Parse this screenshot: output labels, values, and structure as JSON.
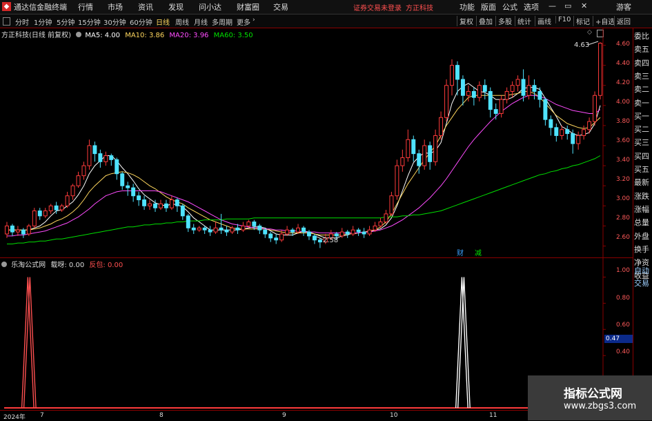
{
  "menubar": {
    "app_title": "通达信金融终端",
    "items": [
      "行情",
      "市场",
      "资讯",
      "发现",
      "问小达",
      "财富圈",
      "交易"
    ],
    "notice": "证券交易未登录",
    "stock_name": "方正科技",
    "right_items": [
      "功能",
      "版面",
      "公式",
      "选项"
    ],
    "guest": "游客"
  },
  "toolbar": {
    "tabs": [
      "分时",
      "1分钟",
      "5分钟",
      "15分钟",
      "30分钟",
      "60分钟",
      "日线",
      "周线",
      "月线",
      "多周期",
      "更多"
    ],
    "active_tab": "日线",
    "right_buttons": [
      "复权",
      "叠加",
      "多股",
      "统计",
      "画线",
      "F10",
      "标记",
      "+自选",
      "返回"
    ]
  },
  "main_chart": {
    "title": "方正科技(日线 前复权)",
    "ma": [
      {
        "label": "MA5: 4.00",
        "color": "#ffffff"
      },
      {
        "label": "MA10: 3.86",
        "color": "#ffd75e"
      },
      {
        "label": "MA20: 3.96",
        "color": "#ff4cff"
      },
      {
        "label": "MA60: 3.50",
        "color": "#00e000"
      }
    ],
    "yticks": [
      "4.60",
      "4.40",
      "4.20",
      "4.00",
      "3.80",
      "3.60",
      "3.40",
      "3.20",
      "3.00",
      "2.80",
      "2.60"
    ],
    "high_label": "4.63",
    "low_label": "2.58",
    "badge_cai": "财",
    "badge_jian": "减"
  },
  "sub_chart": {
    "title": "乐淘公式网",
    "field1": "载呀: 0.00",
    "field2": "反包: 0.00",
    "yticks": [
      "1.00",
      "0.80",
      "0.60",
      "0.40"
    ],
    "current_value": "0.47"
  },
  "xaxis": {
    "labels": [
      "2024年",
      "7",
      "8",
      "9",
      "10",
      "11"
    ]
  },
  "right_panel": [
    "委比",
    "卖五",
    "卖四",
    "卖三",
    "卖二",
    "卖一",
    "买一",
    "买二",
    "买三",
    "买四",
    "买五",
    "最新",
    "涨跌",
    "涨幅",
    "总量",
    "外盘",
    "换手",
    "净资",
    "收益",
    "自动",
    "交易"
  ],
  "brand": {
    "name": "指标公式网",
    "url": "www.zbgs3.com"
  },
  "chart_data": {
    "type": "candlestick",
    "ylim": [
      2.5,
      4.7
    ],
    "candles": [
      [
        2.72,
        2.8,
        2.68,
        2.84
      ],
      [
        2.8,
        2.74,
        2.7,
        2.82
      ],
      [
        2.74,
        2.76,
        2.7,
        2.8
      ],
      [
        2.76,
        2.72,
        2.68,
        2.78
      ],
      [
        2.72,
        2.8,
        2.7,
        2.82
      ],
      [
        2.8,
        2.95,
        2.78,
        2.98
      ],
      [
        2.95,
        2.9,
        2.86,
        2.98
      ],
      [
        2.9,
        2.95,
        2.88,
        2.98
      ],
      [
        2.95,
        3.0,
        2.92,
        3.02
      ],
      [
        3.0,
        2.96,
        2.92,
        3.04
      ],
      [
        2.96,
        3.0,
        2.94,
        3.02
      ],
      [
        3.0,
        3.1,
        2.98,
        3.14
      ],
      [
        3.1,
        3.2,
        3.06,
        3.22
      ],
      [
        3.2,
        3.3,
        3.18,
        3.34
      ],
      [
        3.3,
        3.4,
        3.26,
        3.44
      ],
      [
        3.4,
        3.6,
        3.36,
        3.66
      ],
      [
        3.6,
        3.52,
        3.44,
        3.64
      ],
      [
        3.52,
        3.44,
        3.38,
        3.56
      ],
      [
        3.44,
        3.5,
        3.4,
        3.54
      ],
      [
        3.5,
        3.46,
        3.4,
        3.52
      ],
      [
        3.46,
        3.32,
        3.26,
        3.48
      ],
      [
        3.32,
        3.2,
        3.16,
        3.34
      ],
      [
        3.2,
        3.18,
        3.1,
        3.24
      ],
      [
        3.18,
        3.1,
        3.04,
        3.22
      ],
      [
        3.1,
        3.06,
        3.0,
        3.14
      ],
      [
        3.06,
        3.0,
        2.96,
        3.1
      ],
      [
        3.0,
        3.02,
        2.96,
        3.06
      ],
      [
        3.02,
        2.98,
        2.94,
        3.06
      ],
      [
        2.98,
        3.02,
        2.96,
        3.06
      ],
      [
        3.02,
        2.98,
        2.94,
        3.06
      ],
      [
        2.98,
        3.06,
        2.96,
        3.1
      ],
      [
        3.06,
        3.0,
        2.94,
        3.08
      ],
      [
        3.0,
        2.9,
        2.86,
        3.02
      ],
      [
        2.9,
        2.78,
        2.74,
        2.92
      ],
      [
        2.78,
        2.76,
        2.72,
        2.82
      ],
      [
        2.76,
        2.78,
        2.74,
        2.8
      ],
      [
        2.78,
        2.76,
        2.72,
        2.8
      ],
      [
        2.76,
        2.74,
        2.7,
        2.8
      ],
      [
        2.74,
        2.78,
        2.72,
        2.84
      ],
      [
        2.78,
        2.76,
        2.72,
        2.92
      ],
      [
        2.76,
        2.74,
        2.7,
        2.8
      ],
      [
        2.74,
        2.78,
        2.72,
        2.8
      ],
      [
        2.78,
        2.76,
        2.72,
        2.82
      ],
      [
        2.76,
        2.8,
        2.74,
        2.84
      ],
      [
        2.8,
        2.84,
        2.78,
        2.86
      ],
      [
        2.84,
        2.8,
        2.76,
        2.86
      ],
      [
        2.8,
        2.76,
        2.72,
        2.82
      ],
      [
        2.76,
        2.72,
        2.68,
        2.78
      ],
      [
        2.72,
        2.68,
        2.64,
        2.74
      ],
      [
        2.68,
        2.66,
        2.62,
        2.72
      ],
      [
        2.66,
        2.72,
        2.64,
        2.76
      ],
      [
        2.72,
        2.76,
        2.7,
        2.8
      ],
      [
        2.76,
        2.74,
        2.7,
        2.78
      ],
      [
        2.74,
        2.78,
        2.72,
        2.82
      ],
      [
        2.78,
        2.74,
        2.7,
        2.8
      ],
      [
        2.74,
        2.7,
        2.66,
        2.76
      ],
      [
        2.7,
        2.66,
        2.62,
        2.72
      ],
      [
        2.66,
        2.64,
        2.58,
        2.68
      ],
      [
        2.64,
        2.68,
        2.62,
        2.72
      ],
      [
        2.68,
        2.72,
        2.66,
        2.76
      ],
      [
        2.72,
        2.7,
        2.66,
        2.74
      ],
      [
        2.7,
        2.74,
        2.68,
        2.78
      ],
      [
        2.74,
        2.72,
        2.68,
        2.76
      ],
      [
        2.72,
        2.76,
        2.7,
        2.8
      ],
      [
        2.76,
        2.74,
        2.7,
        2.78
      ],
      [
        2.74,
        2.72,
        2.68,
        2.78
      ],
      [
        2.72,
        2.76,
        2.7,
        2.8
      ],
      [
        2.76,
        2.8,
        2.74,
        2.84
      ],
      [
        2.8,
        2.84,
        2.78,
        2.88
      ],
      [
        2.84,
        2.92,
        2.82,
        2.96
      ],
      [
        2.92,
        3.1,
        2.9,
        3.14
      ],
      [
        3.1,
        3.4,
        3.06,
        3.46
      ],
      [
        3.4,
        3.48,
        3.34,
        3.56
      ],
      [
        3.48,
        3.66,
        3.44,
        3.76
      ],
      [
        3.66,
        3.52,
        3.44,
        3.7
      ],
      [
        3.52,
        3.4,
        3.32,
        3.56
      ],
      [
        3.4,
        3.6,
        3.36,
        3.66
      ],
      [
        3.6,
        3.44,
        3.36,
        3.64
      ],
      [
        3.44,
        3.7,
        3.4,
        3.76
      ],
      [
        3.7,
        3.88,
        3.66,
        3.94
      ],
      [
        3.88,
        4.2,
        3.84,
        4.26
      ],
      [
        4.2,
        4.4,
        4.1,
        4.46
      ],
      [
        4.4,
        4.26,
        4.1,
        4.44
      ],
      [
        4.26,
        4.1,
        4.0,
        4.3
      ],
      [
        4.1,
        4.14,
        4.04,
        4.2
      ],
      [
        4.14,
        4.08,
        4.0,
        4.18
      ],
      [
        4.08,
        4.2,
        4.04,
        4.24
      ],
      [
        4.2,
        4.14,
        4.06,
        4.26
      ],
      [
        4.14,
        3.96,
        3.88,
        4.18
      ],
      [
        3.96,
        3.92,
        3.86,
        4.02
      ],
      [
        3.92,
        4.06,
        3.88,
        4.1
      ],
      [
        4.06,
        4.14,
        4.02,
        4.18
      ],
      [
        4.14,
        4.2,
        4.08,
        4.24
      ],
      [
        4.2,
        4.26,
        4.14,
        4.3
      ],
      [
        4.26,
        4.1,
        4.04,
        4.36
      ],
      [
        4.1,
        4.2,
        4.06,
        4.3
      ],
      [
        4.2,
        4.14,
        4.06,
        4.26
      ],
      [
        4.14,
        4.06,
        3.98,
        4.18
      ],
      [
        4.06,
        3.86,
        3.8,
        4.08
      ],
      [
        3.86,
        3.78,
        3.7,
        3.9
      ],
      [
        3.78,
        3.7,
        3.64,
        3.82
      ],
      [
        3.7,
        3.76,
        3.66,
        3.8
      ],
      [
        3.76,
        3.72,
        3.66,
        3.8
      ],
      [
        3.72,
        3.62,
        3.52,
        3.76
      ],
      [
        3.62,
        3.7,
        3.56,
        3.74
      ],
      [
        3.7,
        3.76,
        3.66,
        3.8
      ],
      [
        3.76,
        3.84,
        3.72,
        3.88
      ],
      [
        3.84,
        4.1,
        3.8,
        4.14
      ],
      [
        4.1,
        4.62,
        4.06,
        4.63
      ]
    ],
    "ma_series": [
      {
        "name": "MA5",
        "color": "#ffffff",
        "values": [
          2.76,
          2.76,
          2.76,
          2.76,
          2.76,
          2.78,
          2.8,
          2.84,
          2.9,
          2.95,
          2.96,
          3.0,
          3.04,
          3.11,
          3.2,
          3.32,
          3.4,
          3.45,
          3.5,
          3.5,
          3.45,
          3.38,
          3.32,
          3.25,
          3.17,
          3.11,
          3.07,
          3.03,
          3.01,
          3.0,
          3.02,
          3.01,
          2.99,
          2.94,
          2.88,
          2.84,
          2.8,
          2.76,
          2.76,
          2.76,
          2.76,
          2.76,
          2.76,
          2.77,
          2.78,
          2.79,
          2.79,
          2.78,
          2.75,
          2.72,
          2.71,
          2.71,
          2.71,
          2.73,
          2.75,
          2.74,
          2.72,
          2.7,
          2.68,
          2.68,
          2.68,
          2.7,
          2.71,
          2.73,
          2.73,
          2.74,
          2.74,
          2.76,
          2.77,
          2.81,
          2.88,
          3.0,
          3.15,
          3.3,
          3.43,
          3.49,
          3.53,
          3.52,
          3.55,
          3.63,
          3.82,
          4.02,
          4.14,
          4.19,
          4.22,
          4.18,
          4.14,
          4.13,
          4.1,
          4.06,
          4.06,
          4.06,
          4.08,
          4.12,
          4.17,
          4.18,
          4.18,
          4.16,
          4.07,
          3.98,
          3.89,
          3.79,
          3.76,
          3.72,
          3.7,
          3.71,
          3.73,
          3.82,
          4.0
        ]
      },
      {
        "name": "MA10",
        "color": "#ffd75e",
        "values": [
          2.76,
          2.76,
          2.76,
          2.76,
          2.76,
          2.77,
          2.78,
          2.8,
          2.82,
          2.85,
          2.87,
          2.9,
          2.94,
          2.99,
          3.06,
          3.14,
          3.2,
          3.25,
          3.3,
          3.32,
          3.33,
          3.34,
          3.33,
          3.31,
          3.28,
          3.24,
          3.2,
          3.17,
          3.13,
          3.09,
          3.06,
          3.04,
          3.02,
          2.98,
          2.95,
          2.92,
          2.89,
          2.86,
          2.84,
          2.82,
          2.8,
          2.78,
          2.77,
          2.77,
          2.77,
          2.77,
          2.77,
          2.77,
          2.76,
          2.75,
          2.74,
          2.73,
          2.73,
          2.73,
          2.73,
          2.73,
          2.72,
          2.71,
          2.71,
          2.71,
          2.71,
          2.71,
          2.72,
          2.72,
          2.73,
          2.74,
          2.75,
          2.76,
          2.79,
          2.84,
          2.92,
          3.02,
          3.12,
          3.22,
          3.3,
          3.38,
          3.46,
          3.53,
          3.6,
          3.7,
          3.8,
          3.88,
          3.96,
          4.02,
          4.08,
          4.1,
          4.1,
          4.1,
          4.1,
          4.1,
          4.1,
          4.1,
          4.11,
          4.12,
          4.14,
          4.14,
          4.12,
          4.08,
          4.02,
          3.96,
          3.9,
          3.86,
          3.82,
          3.8,
          3.78,
          3.77,
          3.78,
          3.83,
          3.88
        ]
      },
      {
        "name": "MA20",
        "color": "#ff4cff",
        "values": [
          2.7,
          2.7,
          2.71,
          2.71,
          2.72,
          2.73,
          2.74,
          2.75,
          2.77,
          2.79,
          2.81,
          2.83,
          2.86,
          2.89,
          2.93,
          2.97,
          3.02,
          3.06,
          3.1,
          3.12,
          3.14,
          3.15,
          3.15,
          3.15,
          3.15,
          3.15,
          3.15,
          3.15,
          3.14,
          3.12,
          3.1,
          3.08,
          3.06,
          3.04,
          3.01,
          2.98,
          2.95,
          2.92,
          2.89,
          2.86,
          2.84,
          2.82,
          2.81,
          2.8,
          2.79,
          2.78,
          2.78,
          2.77,
          2.77,
          2.76,
          2.76,
          2.75,
          2.75,
          2.75,
          2.74,
          2.74,
          2.74,
          2.73,
          2.73,
          2.73,
          2.73,
          2.73,
          2.73,
          2.73,
          2.73,
          2.74,
          2.74,
          2.75,
          2.76,
          2.78,
          2.8,
          2.83,
          2.86,
          2.9,
          2.94,
          2.98,
          3.03,
          3.08,
          3.14,
          3.2,
          3.27,
          3.35,
          3.43,
          3.51,
          3.59,
          3.66,
          3.72,
          3.78,
          3.84,
          3.89,
          3.94,
          3.98,
          4.02,
          4.05,
          4.08,
          4.1,
          4.1,
          4.09,
          4.07,
          4.04,
          4.01,
          3.99,
          3.97,
          3.95,
          3.94,
          3.93,
          3.92,
          3.92,
          3.96
        ]
      },
      {
        "name": "MA60",
        "color": "#00e000",
        "values": [
          2.62,
          2.62,
          2.63,
          2.63,
          2.64,
          2.64,
          2.65,
          2.65,
          2.66,
          2.67,
          2.67,
          2.68,
          2.69,
          2.7,
          2.71,
          2.72,
          2.73,
          2.74,
          2.75,
          2.76,
          2.77,
          2.78,
          2.79,
          2.79,
          2.8,
          2.81,
          2.81,
          2.82,
          2.82,
          2.83,
          2.83,
          2.84,
          2.84,
          2.85,
          2.85,
          2.85,
          2.86,
          2.86,
          2.86,
          2.86,
          2.87,
          2.87,
          2.87,
          2.87,
          2.87,
          2.88,
          2.88,
          2.88,
          2.88,
          2.88,
          2.88,
          2.88,
          2.88,
          2.88,
          2.88,
          2.88,
          2.88,
          2.88,
          2.88,
          2.88,
          2.88,
          2.88,
          2.88,
          2.88,
          2.88,
          2.88,
          2.88,
          2.88,
          2.88,
          2.89,
          2.89,
          2.89,
          2.9,
          2.9,
          2.91,
          2.91,
          2.92,
          2.93,
          2.94,
          2.95,
          2.97,
          2.99,
          3.01,
          3.03,
          3.05,
          3.07,
          3.09,
          3.11,
          3.13,
          3.15,
          3.17,
          3.19,
          3.21,
          3.23,
          3.25,
          3.27,
          3.29,
          3.31,
          3.32,
          3.34,
          3.35,
          3.37,
          3.38,
          3.4,
          3.41,
          3.43,
          3.45,
          3.47,
          3.5
        ]
      }
    ],
    "indicator": {
      "ylim": [
        0,
        1.05
      ],
      "spikes": [
        {
          "index": 4,
          "value": 1.0,
          "color": "#ff5050"
        },
        {
          "index": 83,
          "value": 1.0,
          "color": "#ffffff"
        }
      ]
    }
  }
}
